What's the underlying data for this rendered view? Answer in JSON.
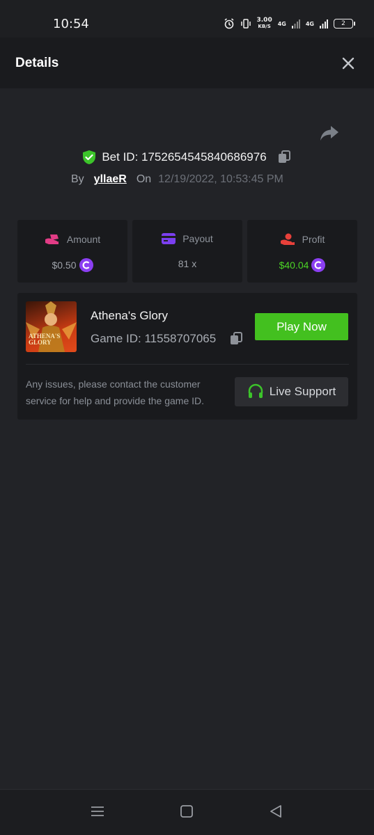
{
  "status_bar": {
    "time": "10:54",
    "speed_value": "3.00",
    "speed_unit": "KB/S",
    "network_1": "4G",
    "network_2": "4G",
    "battery": "2",
    "icons": [
      "alarm-icon",
      "vibrate-icon",
      "signal-icon",
      "signal-icon",
      "battery-icon"
    ]
  },
  "header": {
    "title": "Details",
    "close_icon": "close-icon"
  },
  "bet": {
    "label": "Bet ID: 1752654545840686976",
    "by_label": "By",
    "user": "yllaeR",
    "on_label": "On",
    "date": "12/19/2022, 10:53:45 PM"
  },
  "stats": [
    {
      "label": "Amount",
      "value": "$0.50",
      "icon": "hand-money-icon",
      "color": "#e23c86"
    },
    {
      "label": "Payout",
      "value": "81 x",
      "icon": "card-icon",
      "color": "#7b3ff0"
    },
    {
      "label": "Profit",
      "value": "$40.04",
      "icon": "profit-icon",
      "color": "#e8403a"
    }
  ],
  "game": {
    "thumb_text": "ATHENA'S GLORY",
    "name": "Athena's Glory",
    "id_label": "Game ID: 11558707065",
    "play_label": "Play Now",
    "issue_text": "Any issues, please contact the customer service for help and provide the game ID.",
    "support_label": "Live Support"
  },
  "colors": {
    "accent_green": "#43c01f",
    "coin_purple": "#8b3ff2",
    "background": "#222327"
  }
}
